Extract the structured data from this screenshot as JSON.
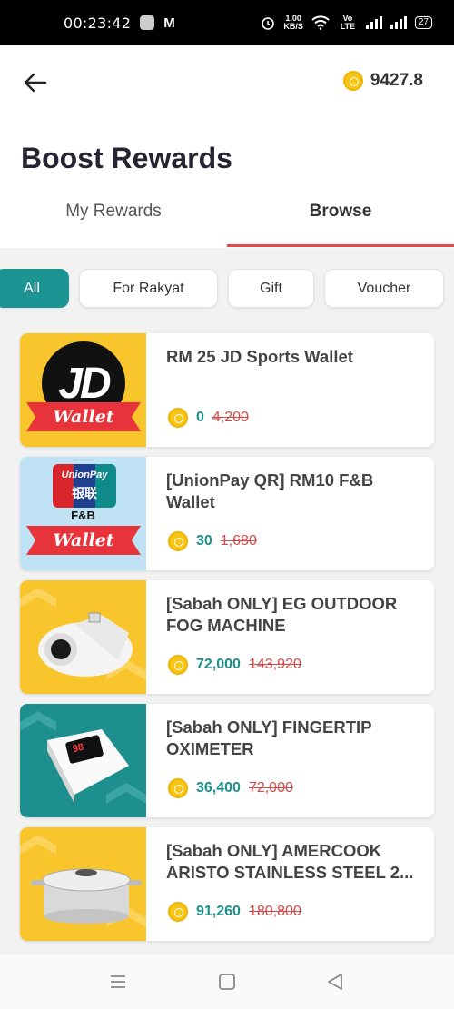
{
  "status_bar": {
    "time": "00:23:42",
    "net_speed_value": "1.00",
    "net_speed_unit": "KB/S",
    "volte": "Vo LTE",
    "battery": "27"
  },
  "header": {
    "coin_balance": "9427.8",
    "title": "Boost Rewards"
  },
  "tabs": [
    {
      "label": "My Rewards",
      "active": false
    },
    {
      "label": "Browse",
      "active": true
    }
  ],
  "filters": [
    {
      "label": "All",
      "active": true
    },
    {
      "label": "For Rakyat",
      "active": false
    },
    {
      "label": "Gift",
      "active": false
    },
    {
      "label": "Voucher",
      "active": false
    }
  ],
  "rewards": [
    {
      "name": "RM 25 JD Sports Wallet",
      "price": "0",
      "original_price": "4,200",
      "thumb_text": "JD",
      "thumb_banner": "Wallet"
    },
    {
      "name": "[UnionPay QR] RM10 F&B Wallet",
      "price": "30",
      "original_price": "1,680",
      "thumb_text": "UnionPay",
      "thumb_text_2": "银联",
      "thumb_sub": "F&B",
      "thumb_banner": "Wallet"
    },
    {
      "name": "[Sabah ONLY] EG OUTDOOR FOG MACHINE",
      "price": "72,000",
      "original_price": "143,920"
    },
    {
      "name": "[Sabah ONLY] FINGERTIP OXIMETER",
      "price": "36,400",
      "original_price": "72,000",
      "thumb_text": "98"
    },
    {
      "name": "[Sabah ONLY] AMERCOOK ARISTO STAINLESS STEEL 2...",
      "price": "91,260",
      "original_price": "180,800"
    }
  ],
  "colors": {
    "accent_teal": "#1c9493",
    "tab_underline": "#e44a4a",
    "old_price": "#d54848",
    "coin": "#f7c516",
    "thumb_yellow": "#f8c52c",
    "thumb_teal": "#1c8f8e",
    "thumb_blue": "#bfe3f5"
  },
  "icons": {
    "back": "arrow-left-icon",
    "coin": "coin-icon",
    "nav": [
      "menu-icon",
      "home-square-icon",
      "back-triangle-icon"
    ]
  }
}
